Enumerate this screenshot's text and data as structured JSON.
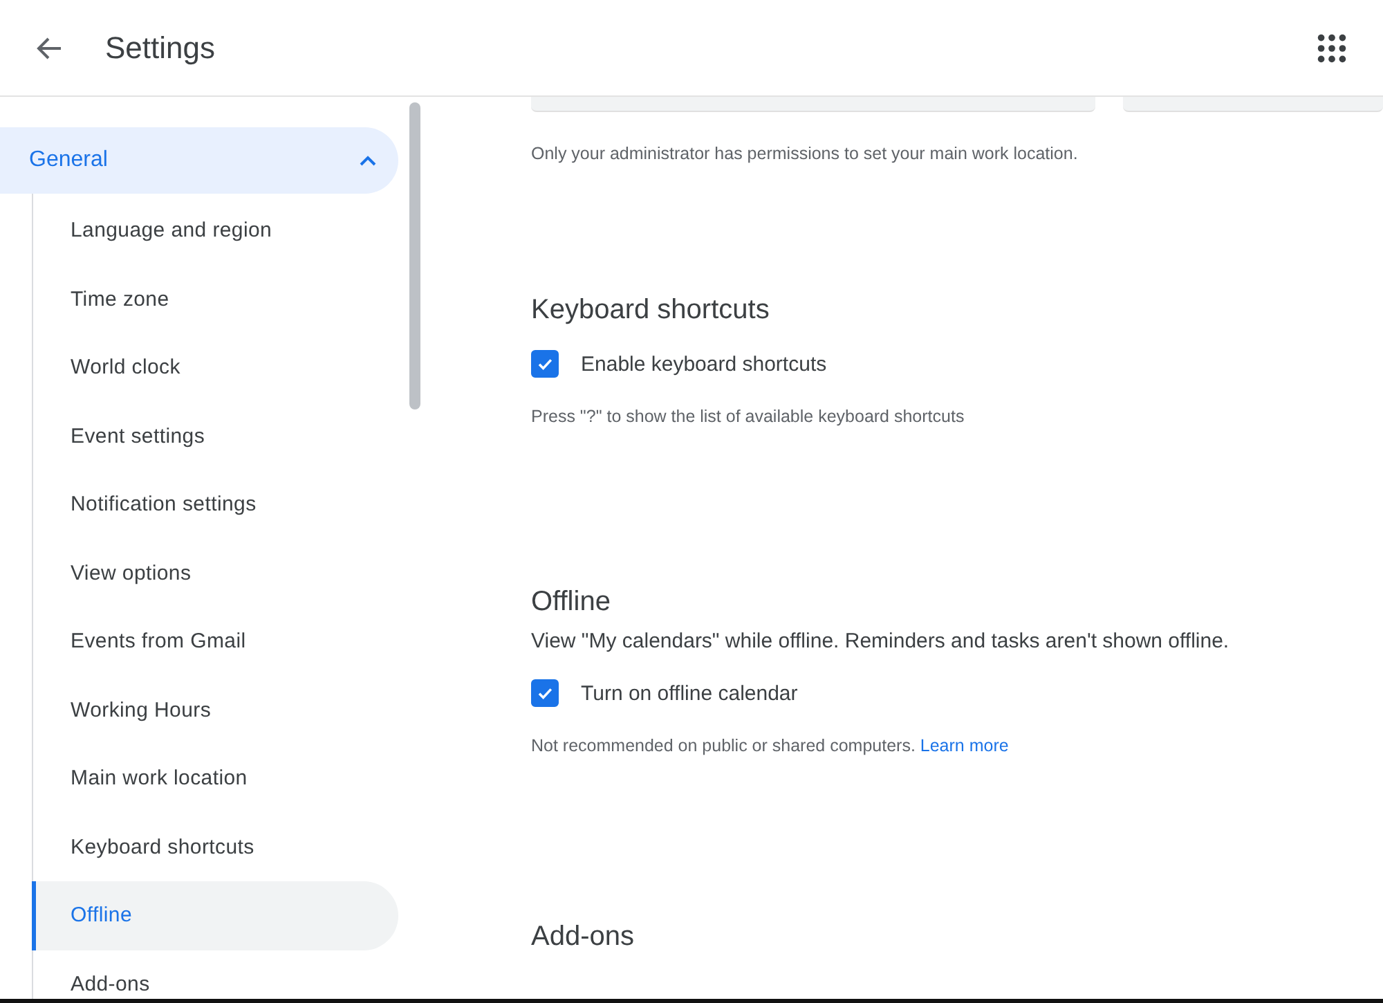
{
  "header": {
    "title": "Settings"
  },
  "sidebar": {
    "group": {
      "label": "General",
      "expanded": true
    },
    "items": [
      {
        "label": "Language and region",
        "selected": false
      },
      {
        "label": "Time zone",
        "selected": false
      },
      {
        "label": "World clock",
        "selected": false
      },
      {
        "label": "Event settings",
        "selected": false
      },
      {
        "label": "Notification settings",
        "selected": false
      },
      {
        "label": "View options",
        "selected": false
      },
      {
        "label": "Events from Gmail",
        "selected": false
      },
      {
        "label": "Working Hours",
        "selected": false
      },
      {
        "label": "Main work location",
        "selected": false
      },
      {
        "label": "Keyboard shortcuts",
        "selected": false
      },
      {
        "label": "Offline",
        "selected": true
      },
      {
        "label": "Add-ons",
        "selected": false
      }
    ]
  },
  "content": {
    "note": "Only your administrator has permissions to set your main work location.",
    "sections": [
      {
        "heading": "Keyboard shortcuts",
        "checkbox": {
          "label": "Enable keyboard shortcuts",
          "checked": true
        },
        "hint": "Press \"?\" to show the list of available keyboard shortcuts"
      },
      {
        "heading": "Offline",
        "description": "View \"My calendars\" while offline. Reminders and tasks aren't shown offline.",
        "checkbox": {
          "label": "Turn on offline calendar",
          "checked": true
        },
        "hint": "Not recommended on public or shared computers.",
        "link": "Learn more"
      },
      {
        "heading": "Add-ons"
      }
    ]
  }
}
